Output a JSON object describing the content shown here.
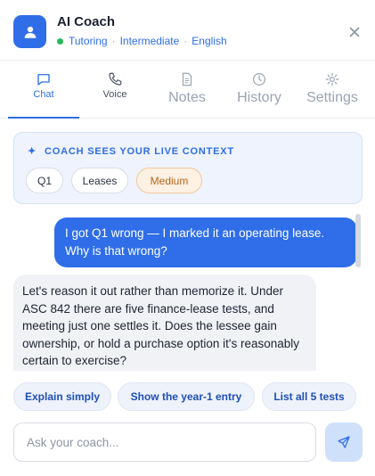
{
  "header": {
    "title": "AI Coach",
    "mode": "Tutoring",
    "level": "Intermediate",
    "language": "English",
    "separator": "·",
    "status_color": "#27b85a",
    "icons": {
      "avatar": "person-icon",
      "close": "close-icon"
    }
  },
  "tabs": [
    {
      "label": "Chat",
      "icon": "chat-bubble-icon",
      "active": true
    },
    {
      "label": "Voice",
      "icon": "phone-icon",
      "active": false
    },
    {
      "label": "Notes",
      "icon": "document-icon",
      "active": false
    },
    {
      "label": "History",
      "icon": "clock-icon",
      "active": false
    },
    {
      "label": "Settings",
      "icon": "gear-icon",
      "active": false
    }
  ],
  "context": {
    "heading": "COACH SEES YOUR LIVE CONTEXT",
    "icon": "sparkle-icon",
    "chips": [
      "Q1",
      "Leases",
      "Medium"
    ]
  },
  "messages": {
    "user": "I got Q1 wrong — I marked it an operating lease. Why is that wrong?",
    "assistant": "Let's reason it out rather than memorize it. Under ASC 842 there are five finance-lease tests, and meeting just one settles it. Does the lessee gain ownership, or hold a purchase option it's reasonably certain to exercise?"
  },
  "suggestions": [
    "Explain simply",
    "Show the year-1 entry",
    "List all 5 tests"
  ],
  "composer": {
    "placeholder": "Ask your coach...",
    "send_icon": "send-icon"
  },
  "colors": {
    "accent": "#2f6ee8",
    "chip_warn_bg": "#fdf1e3",
    "chip_warn_text": "#b5661b"
  }
}
